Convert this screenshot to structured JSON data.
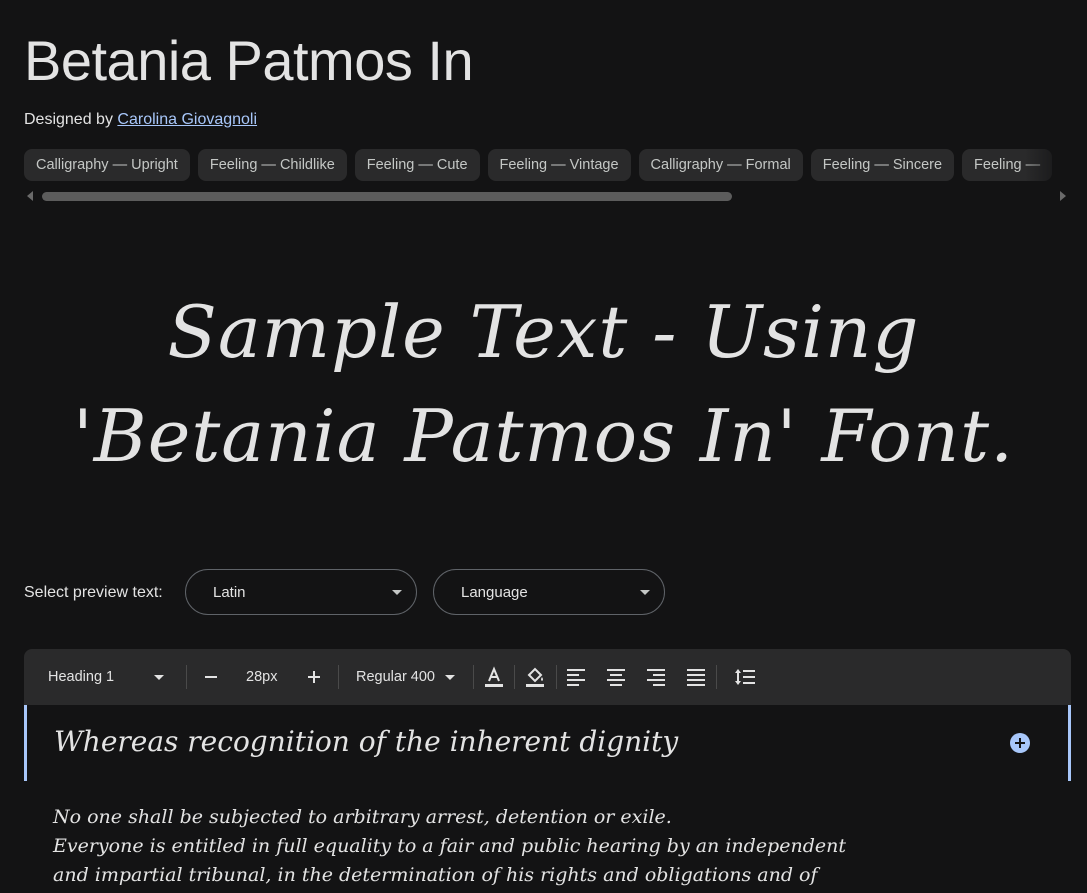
{
  "font": {
    "name": "Betania Patmos In",
    "designed_by_prefix": "Designed by",
    "designer": "Carolina Giovagnoli"
  },
  "tags": [
    "Calligraphy — Upright",
    "Feeling — Childlike",
    "Feeling — Cute",
    "Feeling — Vintage",
    "Calligraphy — Formal",
    "Feeling — Sincere",
    "Feeling —"
  ],
  "sample": {
    "line1": "Sample Text - Using",
    "line2": "'Betania Patmos In' Font."
  },
  "preview": {
    "label": "Select preview text:",
    "script": "Latin",
    "language": "Language"
  },
  "toolbar": {
    "style": "Heading 1",
    "size": "28px",
    "weight": "Regular 400"
  },
  "editor": {
    "heading": "Whereas recognition of the inherent dignity",
    "body_lines": [
      "No one shall be subjected to arbitrary arrest, detention or exile.",
      "Everyone is entitled in full equality to a fair and public hearing by an independent",
      "and impartial tribunal, in the determination of his rights and obligations and of"
    ]
  },
  "colors": {
    "background": "#131314",
    "accent": "#a8c7fa",
    "chip": "#2a2a2b"
  }
}
